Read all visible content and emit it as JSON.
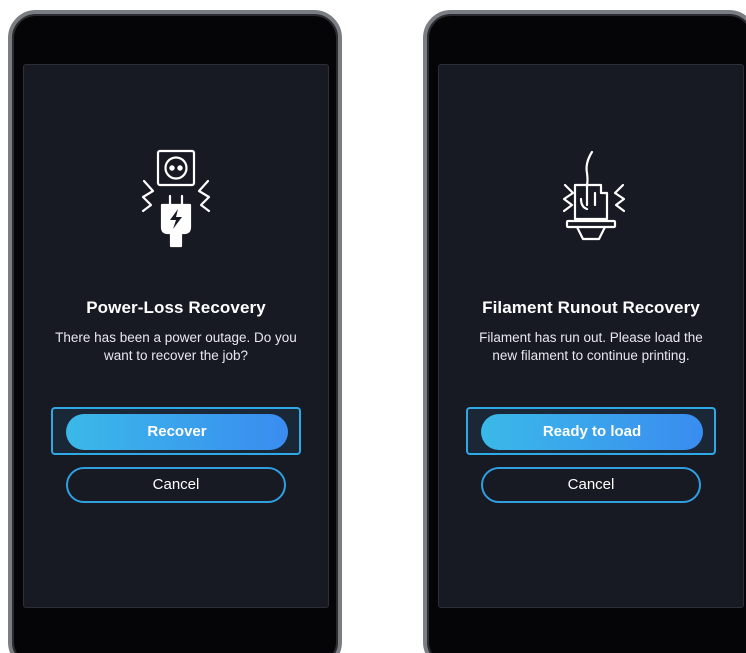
{
  "panels": [
    {
      "illustration_icon": "power-plug-icon",
      "title": "Power-Loss Recovery",
      "message": "There has been a power outage. Do you want to recover the job?",
      "primary_label": "Recover",
      "secondary_label": "Cancel"
    },
    {
      "illustration_icon": "filament-extruder-icon",
      "title": "Filament Runout Recovery",
      "message": "Filament has run out. Please load the new filament to continue printing.",
      "primary_label": "Ready to load",
      "secondary_label": "Cancel"
    }
  ],
  "colors": {
    "screen_background": "#171923",
    "device_frame": "#7a7d82",
    "accent": "#2fa8e6",
    "button_gradient_start": "#3ab9e8",
    "button_gradient_end": "#3a8cf0",
    "text": "#ffffff"
  }
}
